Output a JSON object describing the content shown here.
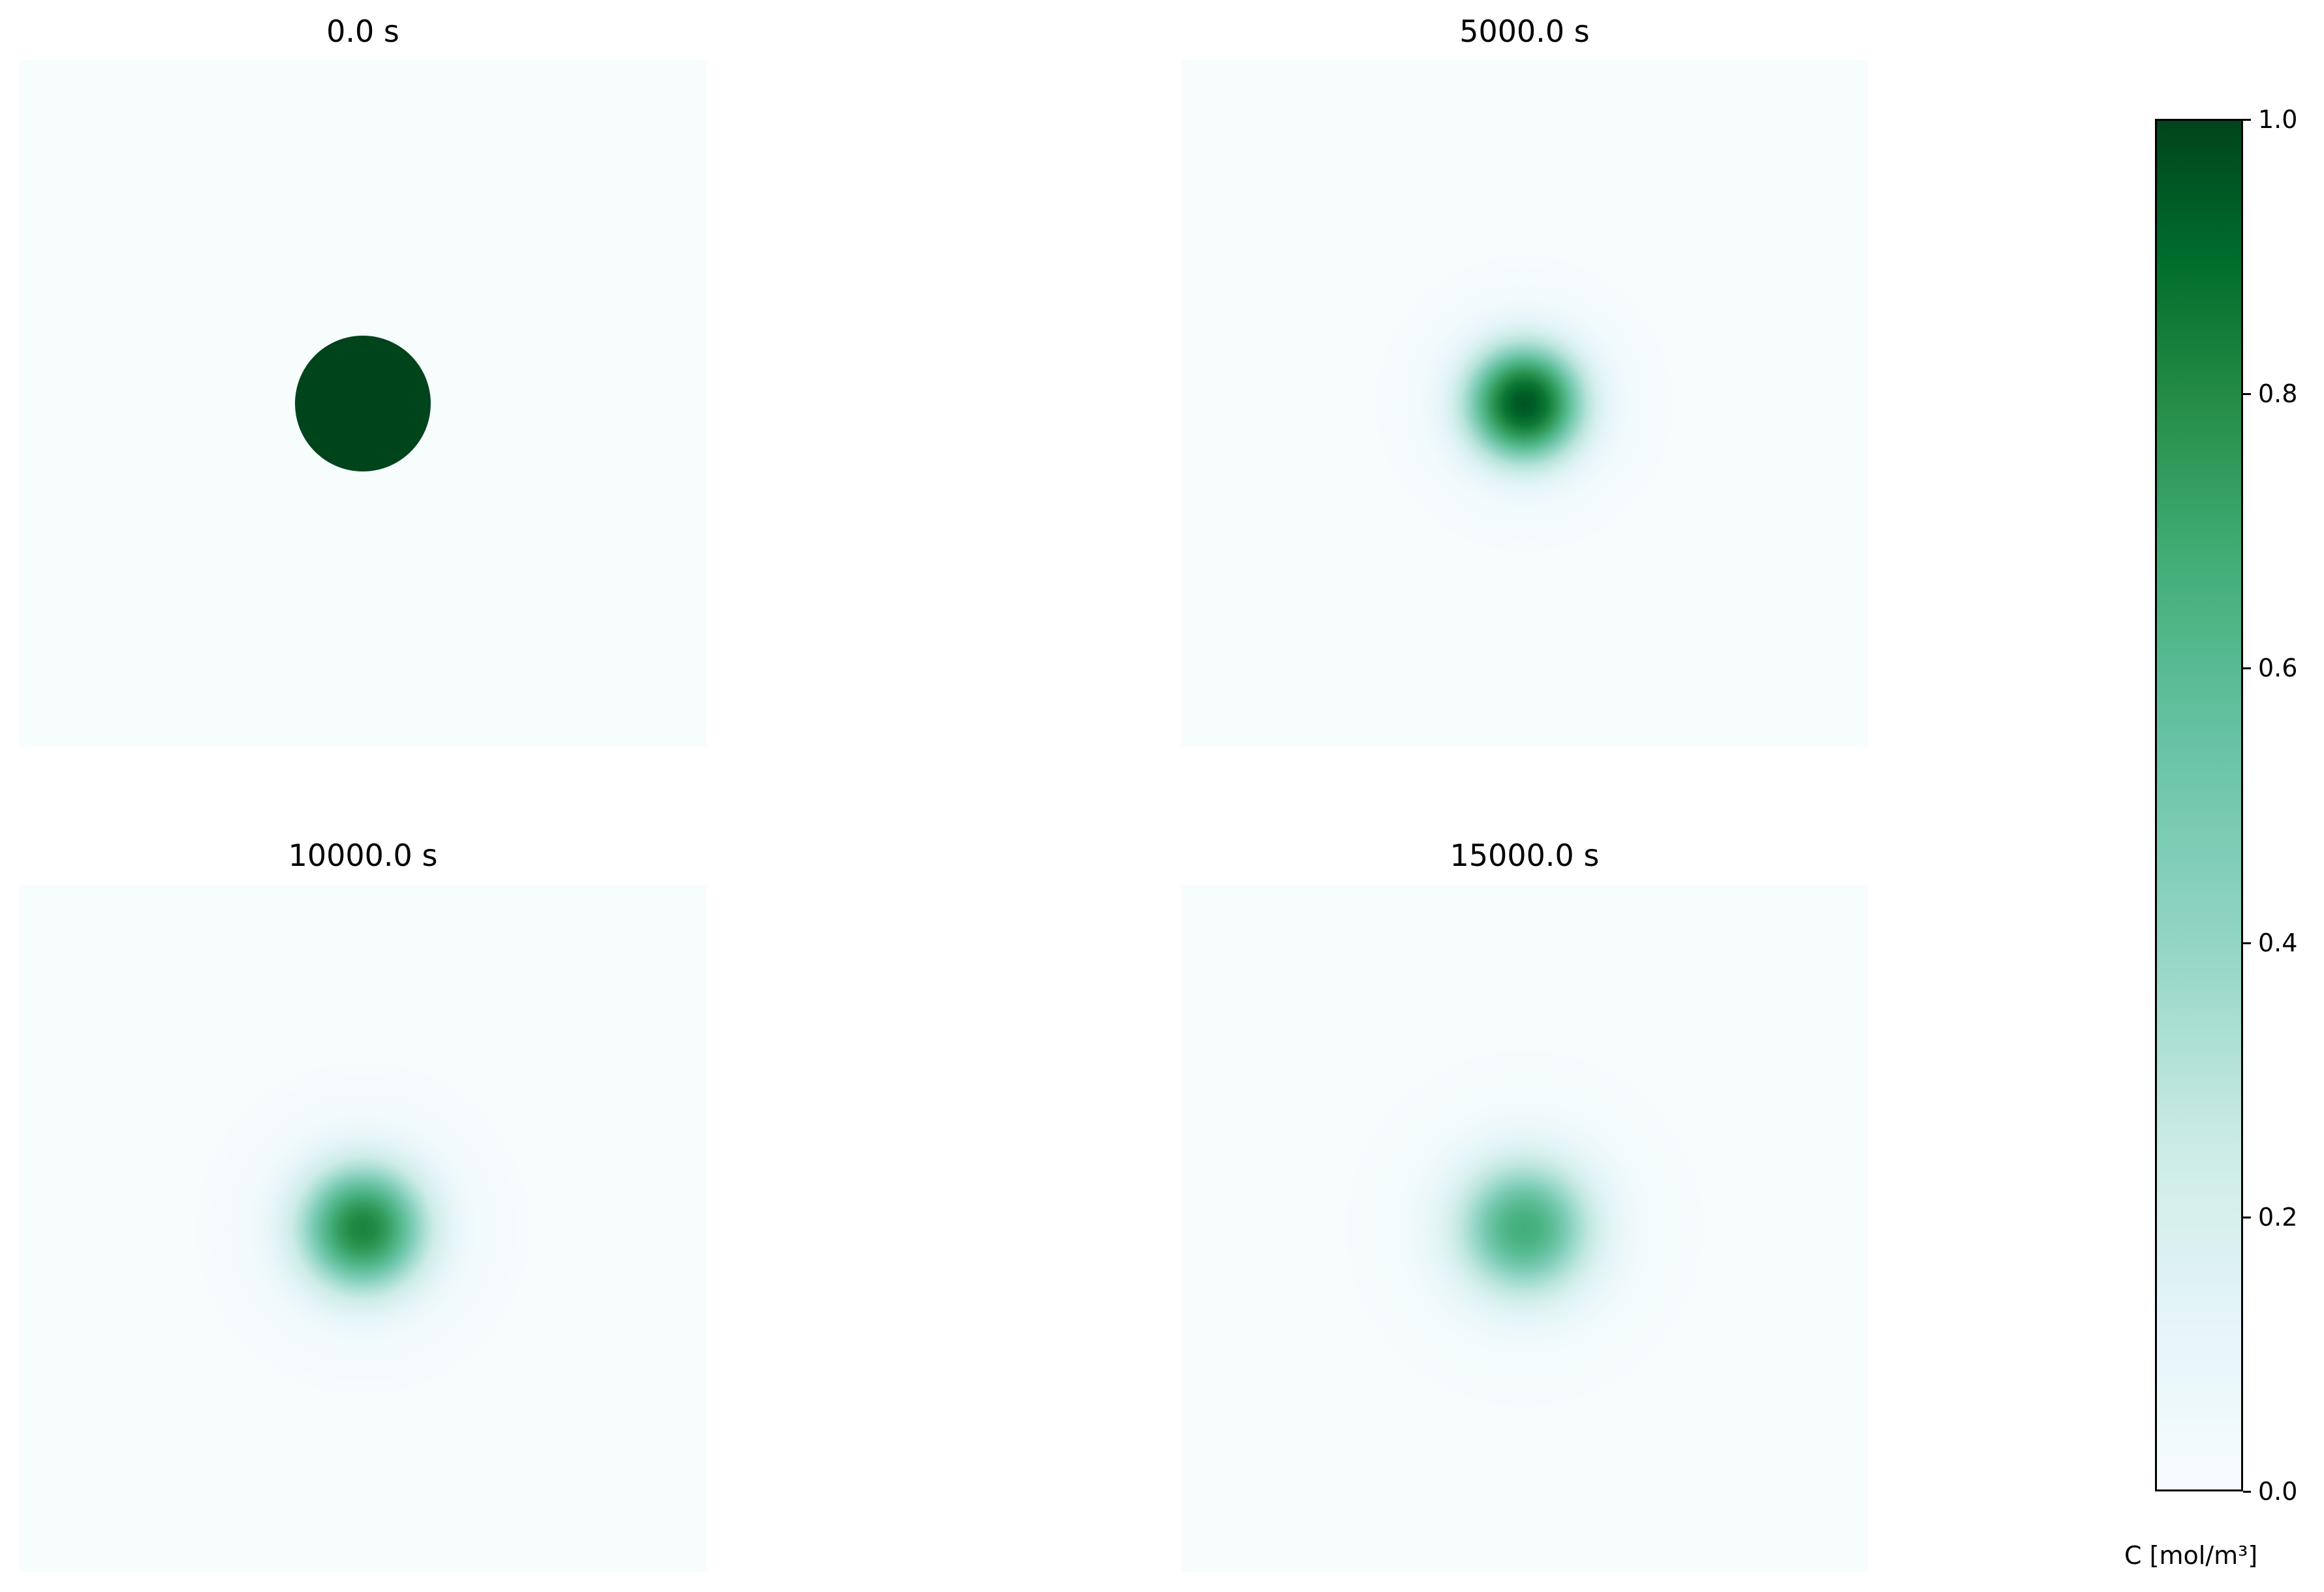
{
  "chart_data": {
    "type": "heatmap",
    "panels": [
      {
        "title": "0.0 s",
        "peak_value": 1.0,
        "profile": "sharp"
      },
      {
        "title": "5000.0 s",
        "peak_value": 0.95,
        "profile": "diffused"
      },
      {
        "title": "10000.0 s",
        "peak_value": 0.78,
        "profile": "diffused"
      },
      {
        "title": "15000.0 s",
        "peak_value": 0.62,
        "profile": "diffused"
      }
    ],
    "background_value": 0.0,
    "colorbar": {
      "label": "C [mol/m³]",
      "range": [
        0.0,
        1.0
      ],
      "ticks": [
        "0.0",
        "0.2",
        "0.4",
        "0.6",
        "0.8",
        "1.0"
      ],
      "colormap": "BuGn",
      "colors": [
        "#f7fcfd",
        "#e5f5f9",
        "#ccece6",
        "#99d8c9",
        "#66c2a4",
        "#41ae76",
        "#238b45",
        "#006d2c",
        "#00441b"
      ]
    }
  }
}
